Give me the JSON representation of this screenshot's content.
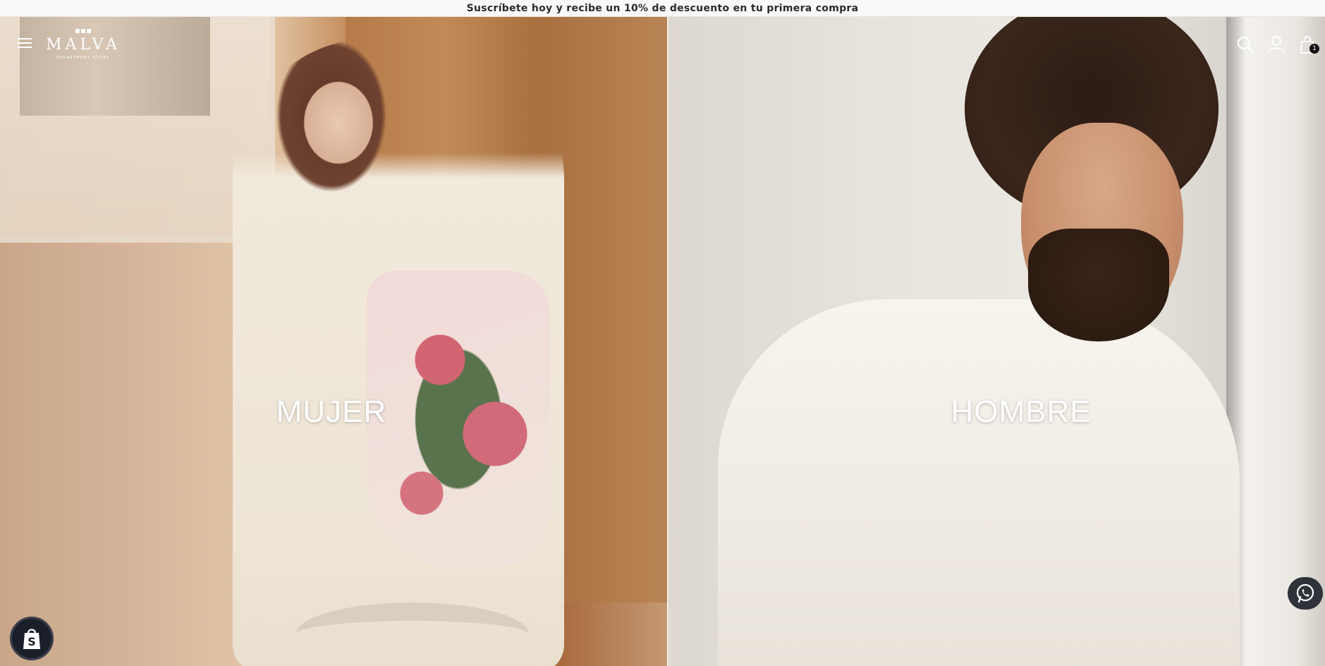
{
  "announcement": {
    "text": "Suscríbete hoy y recibe un 10% de descuento en tu primera compra"
  },
  "header": {
    "menu_icon": "hamburger-menu-icon",
    "logo": {
      "mark": "▪▪▪",
      "name": "MALVA",
      "subtitle": "DEPARTMENT STORE"
    },
    "icons": [
      "search-icon",
      "account-icon",
      "cart-icon"
    ],
    "cart_count": "1"
  },
  "hero": {
    "panels": [
      {
        "label": "MUJER",
        "background_color": "#c9a68a"
      },
      {
        "label": "HOMBRE",
        "background_color": "#e6e2dc"
      }
    ]
  },
  "floating": {
    "shopify_icon": "shopify-bag-icon",
    "whatsapp_icon": "whatsapp-icon"
  },
  "colors": {
    "announcement_bg": "#faf9f7",
    "announcement_text": "#2b2b2b",
    "overlay_text": "#ffffff",
    "floating_button_bg": "#2f3339"
  }
}
